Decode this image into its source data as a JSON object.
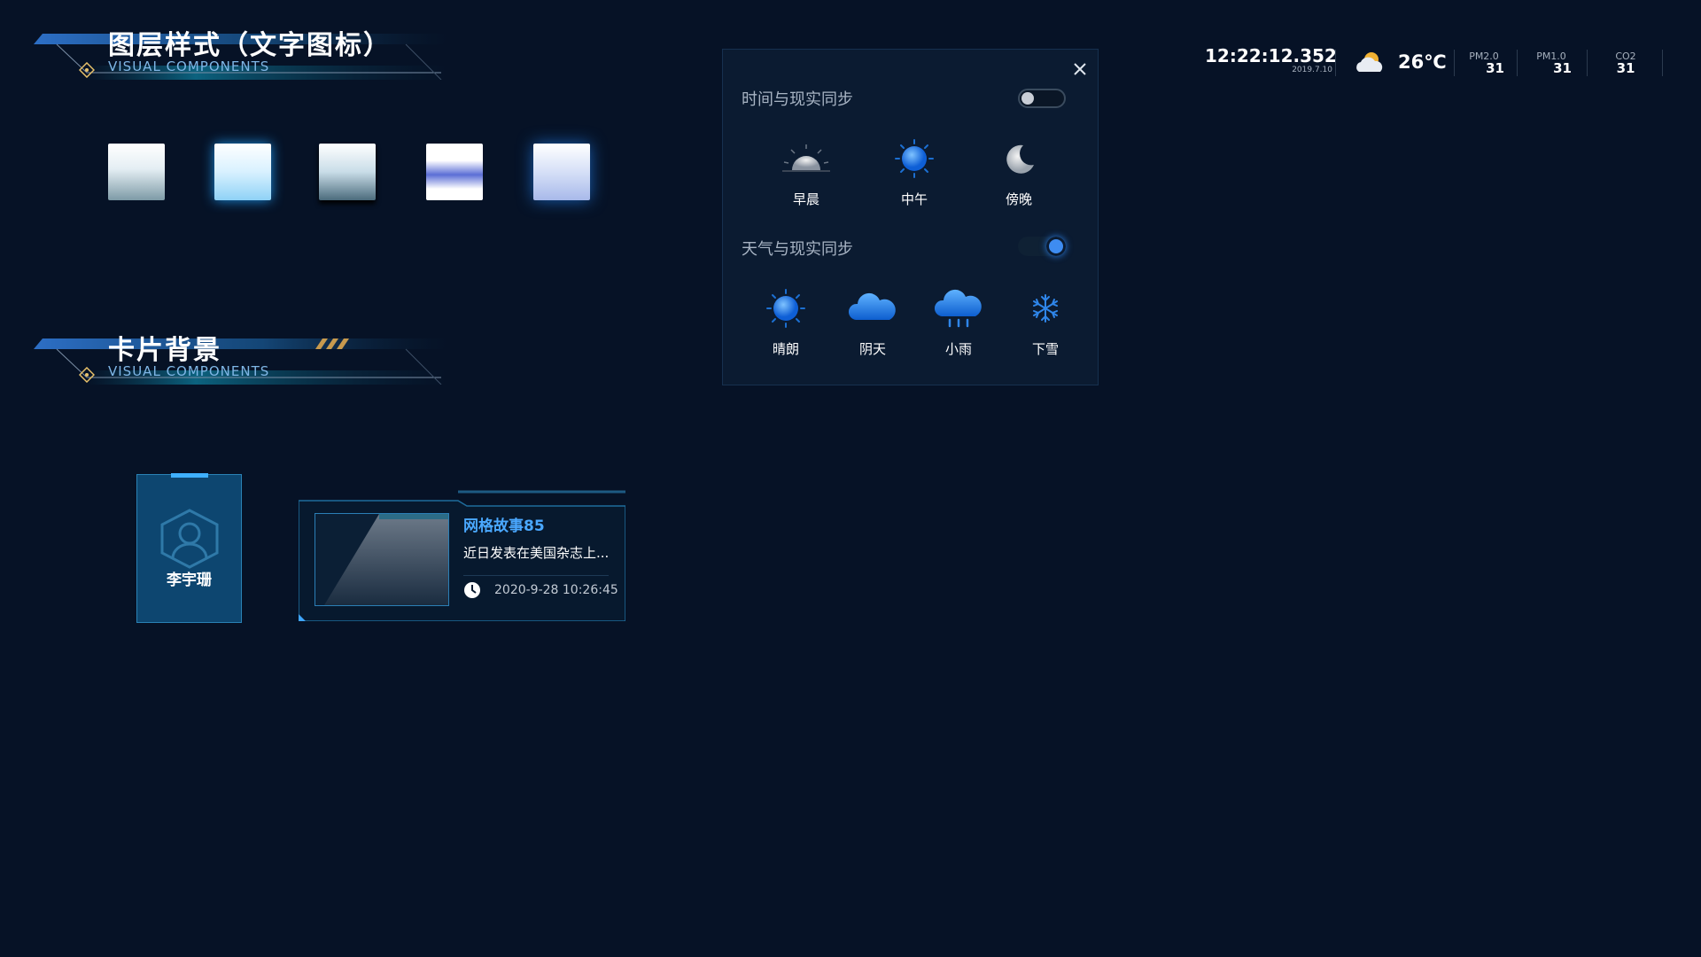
{
  "section1": {
    "title": "图层样式（文字图标）",
    "subtitle": "VISUAL COMPONENTS"
  },
  "section2": {
    "title": "卡片背景",
    "subtitle": "VISUAL COMPONENTS"
  },
  "swatches": [
    {
      "style": "white-to-teal"
    },
    {
      "style": "glow-cyan"
    },
    {
      "style": "white-to-dark"
    },
    {
      "style": "blue-band"
    },
    {
      "style": "lavender-glow"
    }
  ],
  "settings_panel": {
    "close_icon": "close-icon",
    "time_sync": {
      "label": "时间与现实同步",
      "enabled": false
    },
    "time_options": [
      {
        "label": "早晨",
        "icon": "sunrise-icon"
      },
      {
        "label": "中午",
        "icon": "sun-icon"
      },
      {
        "label": "傍晚",
        "icon": "moon-icon"
      }
    ],
    "weather_sync": {
      "label": "天气与现实同步",
      "enabled": true
    },
    "weather_options": [
      {
        "label": "晴朗",
        "icon": "sun-icon"
      },
      {
        "label": "阴天",
        "icon": "cloud-icon"
      },
      {
        "label": "小雨",
        "icon": "rain-icon"
      },
      {
        "label": "下雪",
        "icon": "snowflake-icon"
      }
    ]
  },
  "status_bar": {
    "time": "12:22:12.352",
    "date": "2019.7.10",
    "weather_icon": "partly-cloudy-icon",
    "temperature": "26℃",
    "metrics": [
      {
        "label": "PM2.0",
        "value": "31"
      },
      {
        "label": "PM1.0",
        "value": "31"
      },
      {
        "label": "CO2",
        "value": "31"
      }
    ]
  },
  "person_card": {
    "name": "李宇珊",
    "icon": "user-icon"
  },
  "news_card": {
    "title": "网格故事85",
    "summary": "近日发表在美国杂志上...",
    "timestamp": "2020-9-28 10:26:45",
    "icon": "clock-icon"
  },
  "colors": {
    "background": "#061226",
    "accent": "#3e8cf1",
    "panel": "#0b1b31",
    "title_blue": "#4aa8ff"
  }
}
